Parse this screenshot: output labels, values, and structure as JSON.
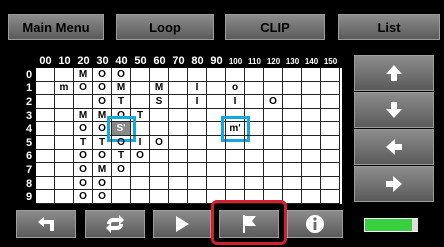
{
  "tabs": [
    "Main Menu",
    "Loop",
    "CLIP",
    "List"
  ],
  "columns": [
    "00",
    "10",
    "20",
    "30",
    "40",
    "50",
    "60",
    "70",
    "80",
    "90",
    "100",
    "110",
    "120",
    "130",
    "140",
    "150"
  ],
  "rows": [
    "0",
    "1",
    "2",
    "3",
    "4",
    "5",
    "6",
    "7",
    "8",
    "9"
  ],
  "grid": [
    [
      "",
      "",
      "M",
      "O",
      "O",
      "",
      "",
      "",
      "",
      "",
      "",
      "",
      "",
      "",
      "",
      ""
    ],
    [
      "",
      "m",
      "O",
      "O",
      "M",
      "",
      "M",
      "",
      "I",
      "",
      "o",
      "",
      "",
      "",
      "",
      ""
    ],
    [
      "",
      "",
      "",
      "O",
      "T",
      "",
      "S",
      "",
      "I",
      "",
      "I",
      "",
      "O",
      "",
      "",
      ""
    ],
    [
      "",
      "",
      "M",
      "M",
      "O",
      "T",
      "",
      "",
      "",
      "",
      "",
      "",
      "",
      "",
      "",
      ""
    ],
    [
      "",
      "",
      "O",
      "O",
      "S'",
      "",
      "",
      "",
      "",
      "",
      "m'",
      "",
      "",
      "",
      "",
      ""
    ],
    [
      "",
      "",
      "T",
      "T",
      "O",
      "I",
      "O",
      "",
      "",
      "",
      "",
      "",
      "",
      "",
      "",
      ""
    ],
    [
      "",
      "",
      "O",
      "O",
      "T",
      "O",
      "",
      "",
      "",
      "",
      "",
      "",
      "",
      "",
      "",
      ""
    ],
    [
      "",
      "",
      "O",
      "M",
      "O",
      "",
      "",
      "",
      "",
      "",
      "",
      "",
      "",
      "",
      "",
      ""
    ],
    [
      "",
      "",
      "O",
      "O",
      "",
      "",
      "",
      "",
      "",
      "",
      "",
      "",
      "",
      "",
      "",
      ""
    ],
    [
      "",
      "",
      "O",
      "O",
      "",
      "",
      "",
      "",
      "",
      "",
      "",
      "",
      "",
      "",
      "",
      ""
    ]
  ],
  "highlighted_cells": [
    "S'",
    "m'"
  ],
  "side_buttons": [
    "arrow-up-icon",
    "arrow-down-icon",
    "arrow-left-icon",
    "arrow-right-icon"
  ],
  "bottom_buttons": [
    "back-icon",
    "repeat-icon",
    "play-icon",
    "flag-icon",
    "info-icon"
  ],
  "colors": {
    "highlight": "#11a8e4",
    "flag_highlight": "#d41f2c",
    "battery": "#39d03f"
  }
}
